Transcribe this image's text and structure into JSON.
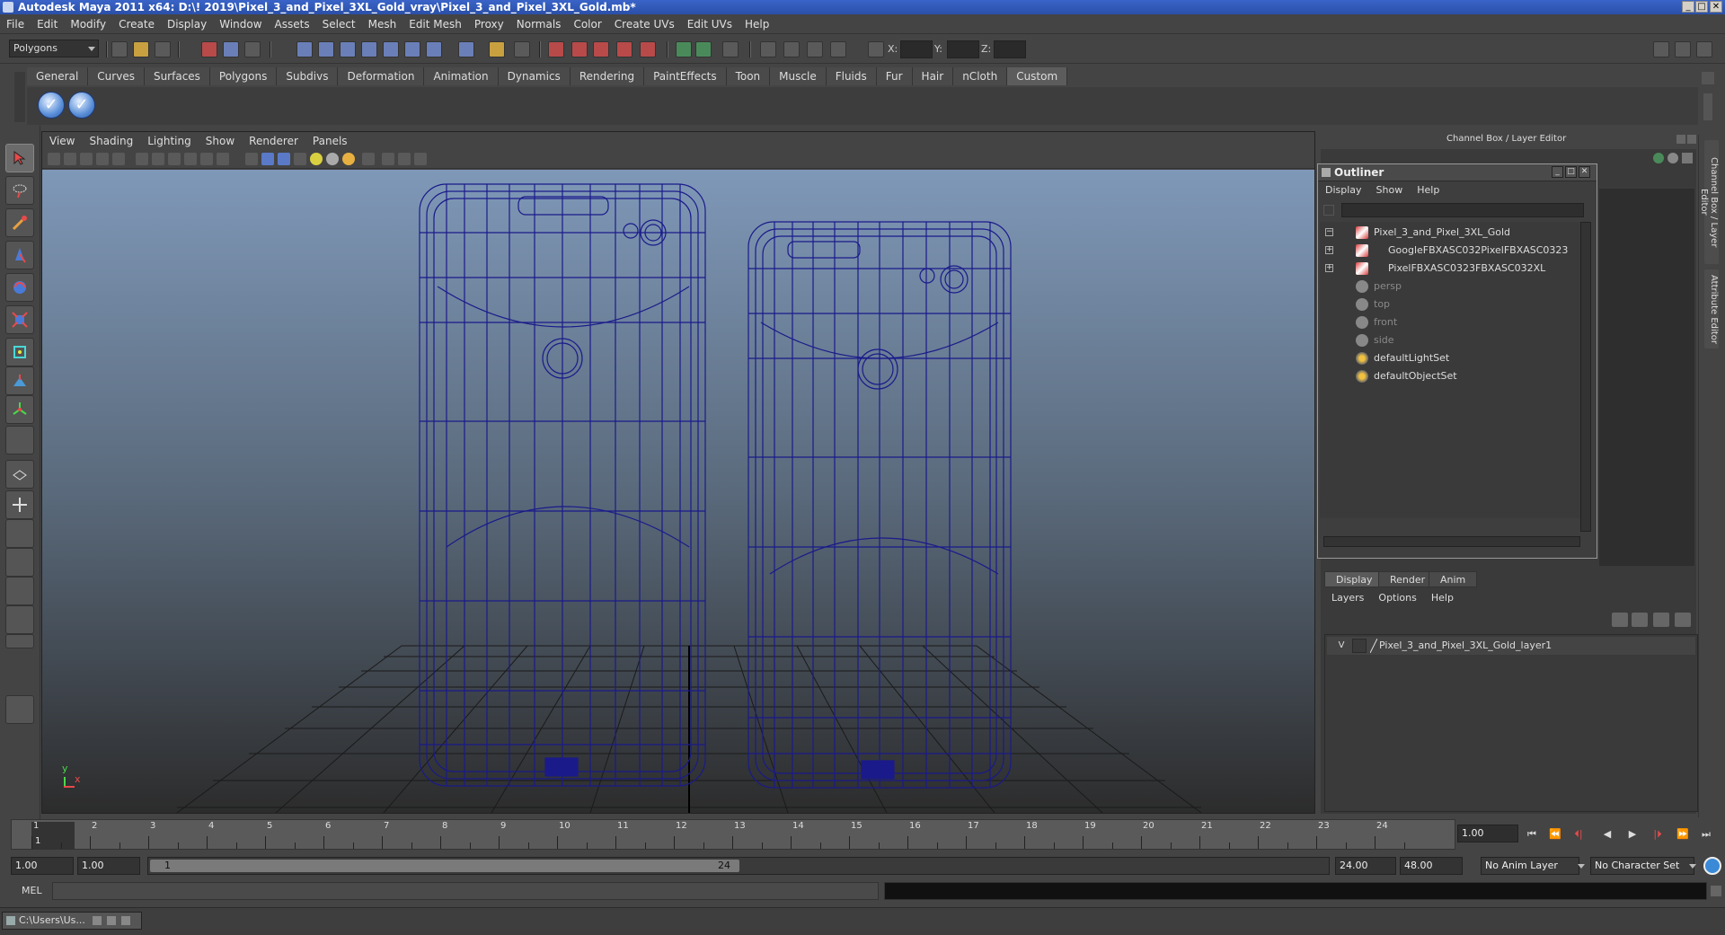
{
  "window": {
    "title": "Autodesk Maya 2011 x64: D:\\! 2019\\Pixel_3_and_Pixel_3XL_Gold_vray\\Pixel_3_and_Pixel_3XL_Gold.mb*",
    "minimize": "_",
    "maximize": "□",
    "close": "✕"
  },
  "menu": [
    "File",
    "Edit",
    "Modify",
    "Create",
    "Display",
    "Window",
    "Assets",
    "Select",
    "Mesh",
    "Edit Mesh",
    "Proxy",
    "Normals",
    "Color",
    "Create UVs",
    "Edit UVs",
    "Help"
  ],
  "status_line": {
    "mode": "Polygons",
    "x_label": "X:",
    "y_label": "Y:",
    "z_label": "Z:"
  },
  "shelf": {
    "tabs": [
      "General",
      "Curves",
      "Surfaces",
      "Polygons",
      "Subdivs",
      "Deformation",
      "Animation",
      "Dynamics",
      "Rendering",
      "PaintEffects",
      "Toon",
      "Muscle",
      "Fluids",
      "Fur",
      "Hair",
      "nCloth",
      "Custom"
    ],
    "active_tab": "Custom",
    "icon_glyph": "✓"
  },
  "panel_menu": [
    "View",
    "Shading",
    "Lighting",
    "Show",
    "Renderer",
    "Panels"
  ],
  "channel_box": {
    "title": "Channel Box / Layer Editor",
    "side_tabs": [
      "Channel Box / Layer Editor",
      "Attribute Editor"
    ]
  },
  "outliner": {
    "title": "Outliner",
    "menu": [
      "Display",
      "Show",
      "Help"
    ],
    "items": [
      {
        "label": "Pixel_3_and_Pixel_3XL_Gold",
        "type": "mesh",
        "expander": "−",
        "indent": 0,
        "dim": false
      },
      {
        "label": "GoogleFBXASC032PixelFBXASC0323",
        "type": "mesh",
        "expander": "+",
        "indent": 1,
        "dim": false
      },
      {
        "label": "PixelFBXASC0323FBXASC032XL",
        "type": "mesh",
        "expander": "+",
        "indent": 1,
        "dim": false
      },
      {
        "label": "persp",
        "type": "cam",
        "expander": "",
        "indent": 0,
        "dim": true
      },
      {
        "label": "top",
        "type": "cam",
        "expander": "",
        "indent": 0,
        "dim": true
      },
      {
        "label": "front",
        "type": "cam",
        "expander": "",
        "indent": 0,
        "dim": true
      },
      {
        "label": "side",
        "type": "cam",
        "expander": "",
        "indent": 0,
        "dim": true
      },
      {
        "label": "defaultLightSet",
        "type": "set",
        "expander": "",
        "indent": 0,
        "dim": false
      },
      {
        "label": "defaultObjectSet",
        "type": "set",
        "expander": "",
        "indent": 0,
        "dim": false
      }
    ]
  },
  "layer_editor": {
    "tabs": [
      "Display",
      "Render",
      "Anim"
    ],
    "active_tab": "Display",
    "menu": [
      "Layers",
      "Options",
      "Help"
    ],
    "layers": [
      {
        "visible": "V",
        "name": "Pixel_3_and_Pixel_3XL_Gold_layer1"
      }
    ]
  },
  "viewport": {
    "axis_y": "y",
    "axis_x": "x"
  },
  "time_slider": {
    "ticks": [
      "1",
      "2",
      "3",
      "4",
      "5",
      "6",
      "7",
      "8",
      "9",
      "10",
      "11",
      "12",
      "13",
      "14",
      "15",
      "16",
      "17",
      "18",
      "19",
      "20",
      "21",
      "22",
      "23",
      "24"
    ],
    "current_frame": "1",
    "frame_field": "1.00"
  },
  "playback": [
    "⏮",
    "⏪",
    "⏴|",
    "◀",
    "▶",
    "|⏵",
    "⏩",
    "⏭"
  ],
  "range": {
    "start": "1.00",
    "playback_start": "1.00",
    "range_start": "1",
    "range_end": "24",
    "playback_end": "24.00",
    "end": "48.00",
    "anim_layer": "No Anim Layer",
    "character_set": "No Character Set"
  },
  "command_line": {
    "label": "MEL"
  },
  "taskbar": {
    "item": "C:\\Users\\Us..."
  }
}
